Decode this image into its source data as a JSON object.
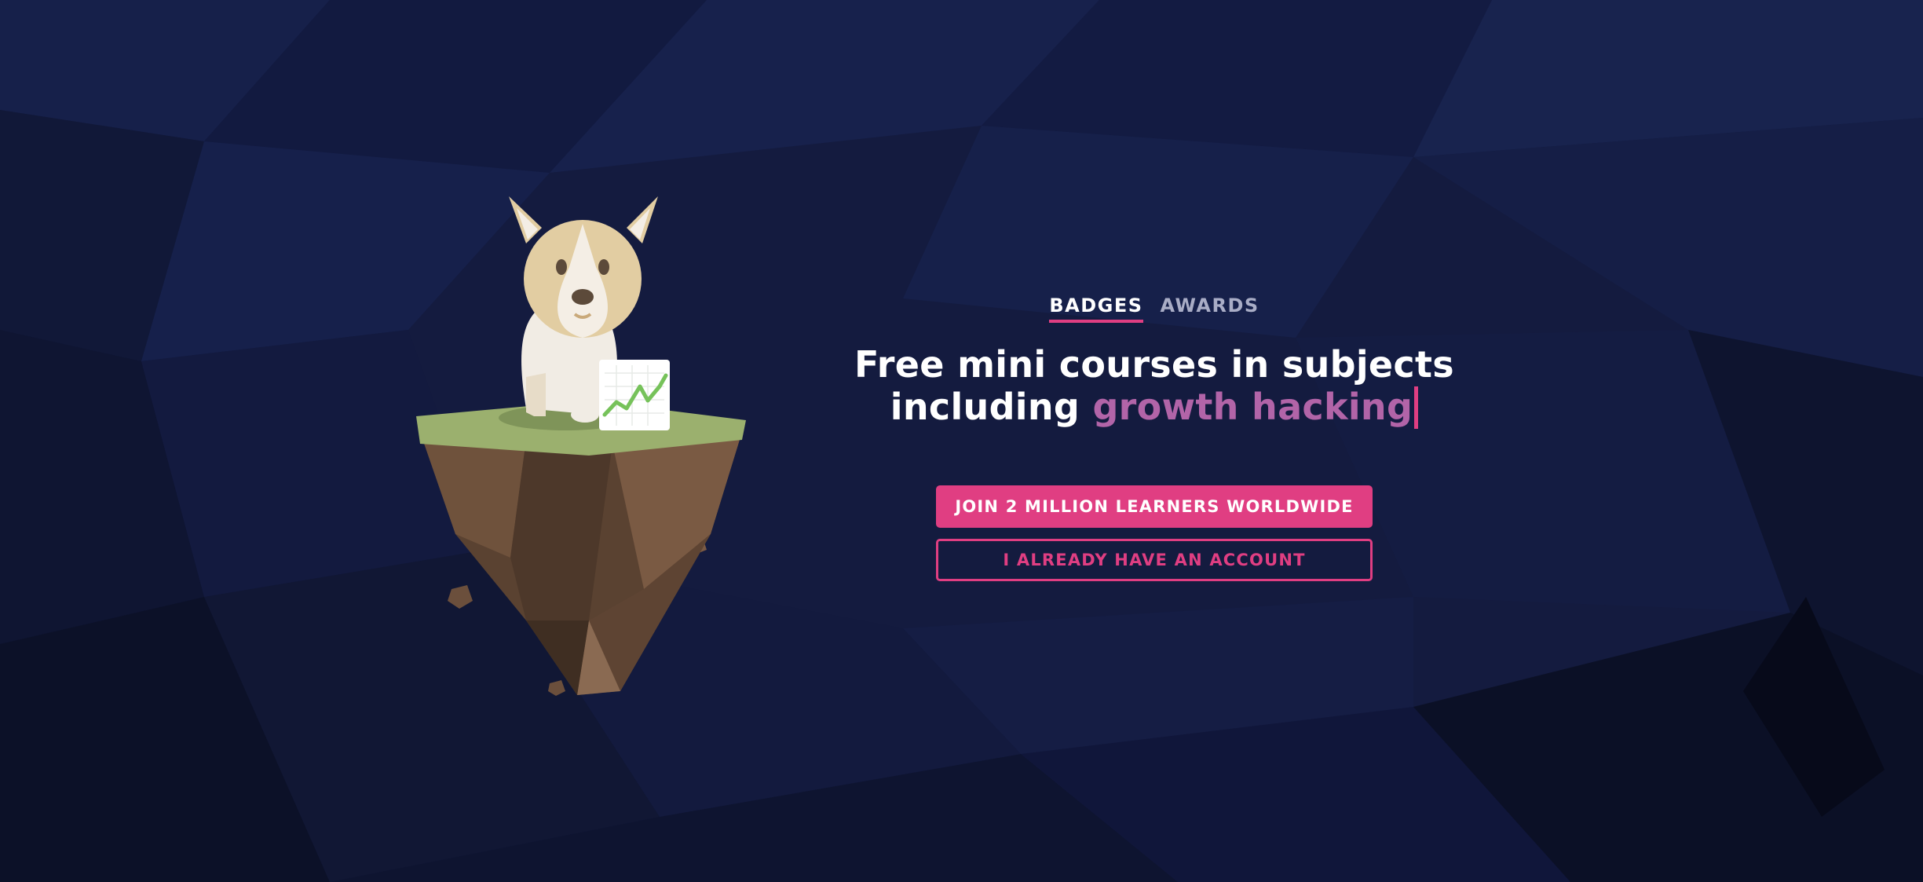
{
  "tabs": [
    {
      "label": "BADGES",
      "active": true
    },
    {
      "label": "AWARDS",
      "active": false
    }
  ],
  "headline": {
    "line1": "Free mini courses in subjects",
    "line2_prefix": "including ",
    "line2_highlight": "growth hacking"
  },
  "buttons": {
    "primary": "JOIN 2 MILLION LEARNERS WORLDWIDE",
    "secondary": "I ALREADY HAVE AN ACCOUNT"
  },
  "colors": {
    "background": "#141b3f",
    "accent": "#e03e82",
    "highlight_text": "#b264a8"
  },
  "illustration": {
    "subject": "corgi-on-floating-island-with-chart",
    "chart_trend": "upward"
  }
}
